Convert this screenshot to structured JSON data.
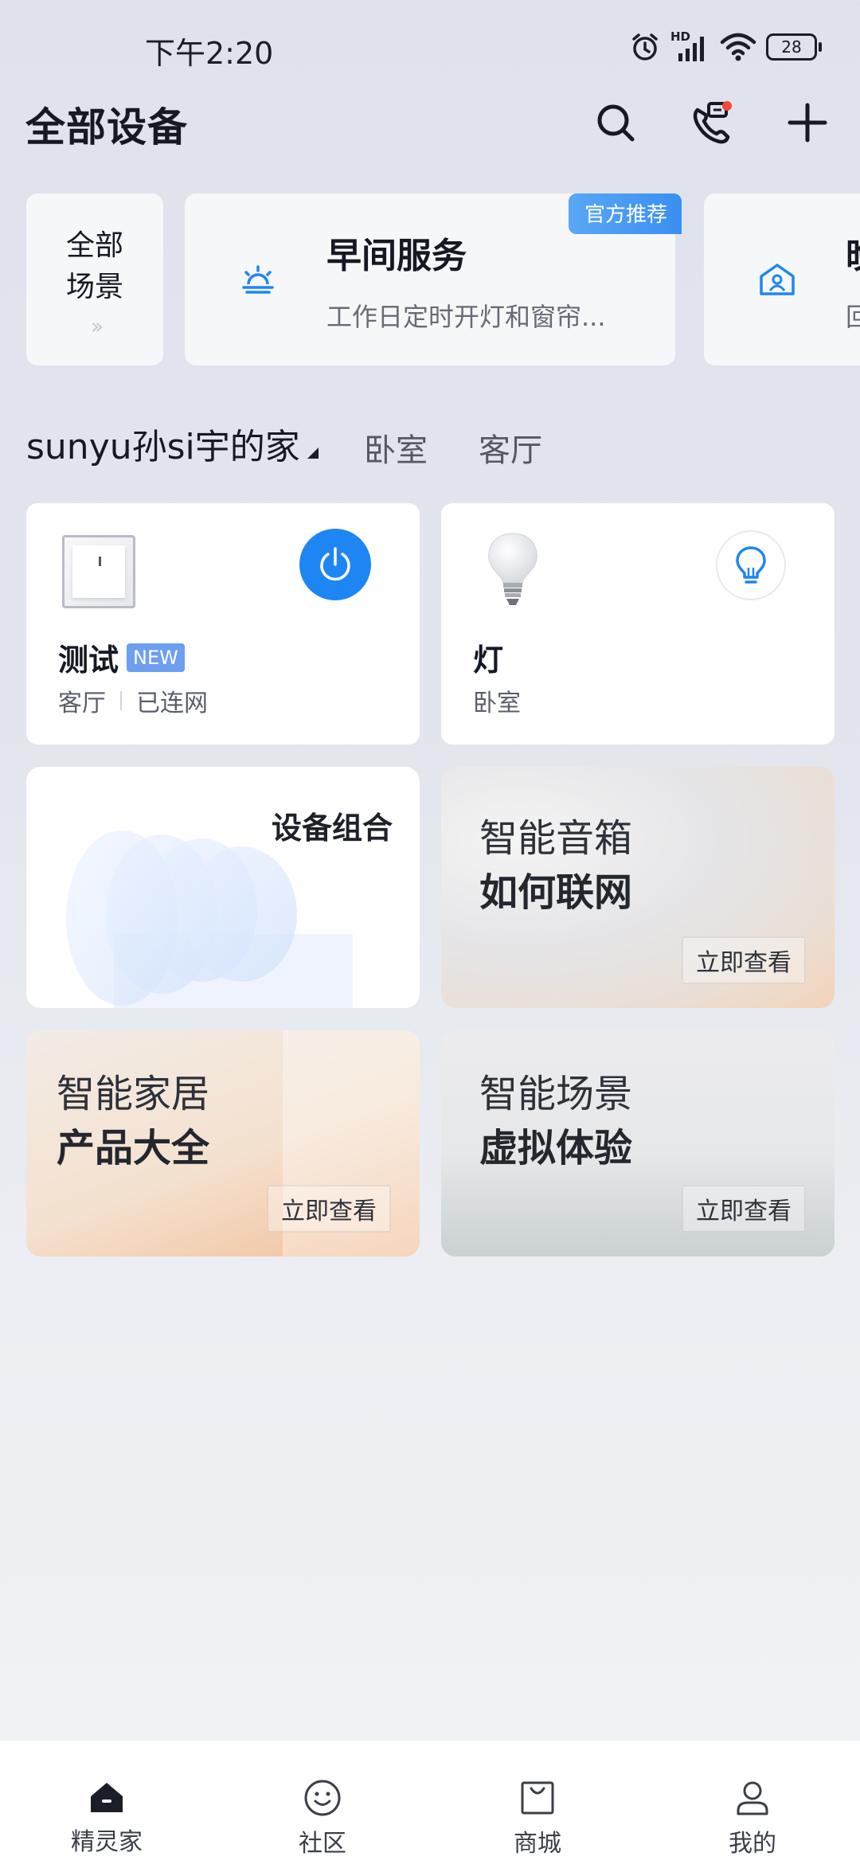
{
  "status_bar": {
    "time": "下午2:20",
    "network": "HD",
    "battery": "28"
  },
  "header": {
    "title": "全部设备"
  },
  "scenes": {
    "all_line1": "全部",
    "all_line2": "场景",
    "cards": [
      {
        "title": "早间服务",
        "desc": "工作日定时开灯和窗帘...",
        "badge": "官方推荐"
      },
      {
        "title": "晚",
        "desc": "回"
      }
    ]
  },
  "home": {
    "name": "sunyu孙si宇的家",
    "rooms": [
      "卧室",
      "客厅"
    ]
  },
  "devices": [
    {
      "name": "测试",
      "badge": "NEW",
      "room": "客厅",
      "status": "已连网"
    },
    {
      "name": "灯",
      "room": "卧室"
    }
  ],
  "promos": [
    {
      "title": "设备组合"
    },
    {
      "line1": "智能音箱",
      "line2": "如何联网",
      "button": "立即查看"
    },
    {
      "line1": "智能家居",
      "line2": "产品大全",
      "button": "立即查看"
    },
    {
      "line1": "智能场景",
      "line2": "虚拟体验",
      "button": "立即查看"
    }
  ],
  "nav": [
    "精灵家",
    "社区",
    "商城",
    "我的"
  ],
  "colors": {
    "accent": "#1e86f3",
    "badge_blue": "#3a8ff0",
    "notification_dot": "#f0493a"
  }
}
